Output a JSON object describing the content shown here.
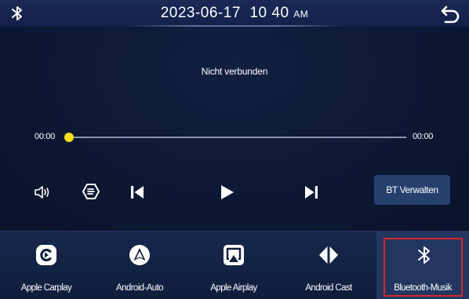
{
  "status_bar": {
    "date": "2023-06-17",
    "time": "10 40",
    "ampm": "AM",
    "left_icon": "bluetooth-icon",
    "right_icon": "back-arrow-icon"
  },
  "player": {
    "connection_status": "Nicht verbunden",
    "time_current": "00:00",
    "time_total": "00:00",
    "progress": 0,
    "controls": [
      "volume-icon",
      "equalizer-icon",
      "previous-track-icon",
      "play-icon",
      "next-track-icon"
    ],
    "bt_manage_label": "BT Verwalten"
  },
  "dock": {
    "items": [
      {
        "label": "Apple Carplay",
        "icon": "carplay-icon"
      },
      {
        "label": "Android-Auto",
        "icon": "android-auto-icon"
      },
      {
        "label": "Apple Airplay",
        "icon": "airplay-icon"
      },
      {
        "label": "Android Cast",
        "icon": "android-cast-icon"
      },
      {
        "label": "Bluetooth-Musik",
        "icon": "bluetooth-icon",
        "active": true
      }
    ]
  },
  "colors": {
    "background": "#0c1730",
    "progress_knob": "#f6de1f",
    "button_bg": "#26406e",
    "active_outline": "#d42a2a"
  }
}
